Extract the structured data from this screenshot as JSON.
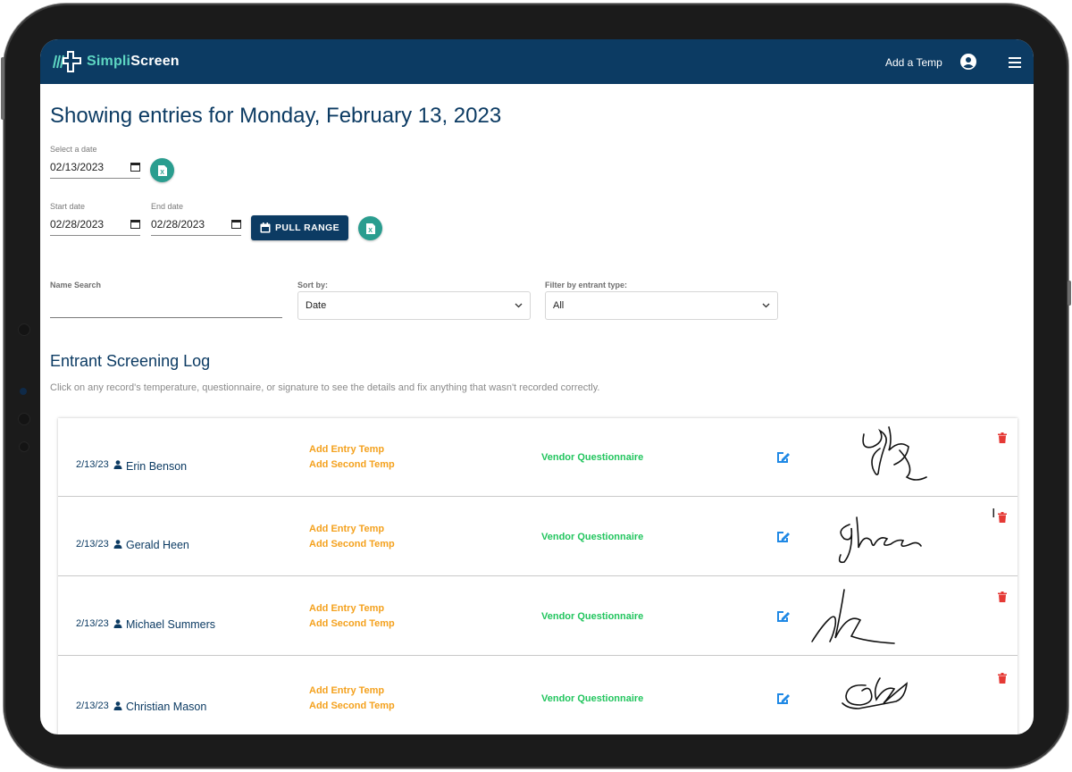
{
  "app": {
    "brand_part1": "Simpli",
    "brand_part2": "Screen",
    "add_temp_label": "Add a Temp",
    "icons": {
      "logo": "simpliscreen-logo",
      "user": "user-circle-icon",
      "menu": "hamburger-menu-icon"
    }
  },
  "page": {
    "title": "Showing entries for Monday, February 13, 2023"
  },
  "date_select": {
    "label": "Select a date",
    "value": "02/13/2023"
  },
  "range": {
    "start_label": "Start date",
    "start_value": "02/28/2023",
    "end_label": "End date",
    "end_value": "02/28/2023",
    "pull_button_label": "PULL RANGE"
  },
  "filters": {
    "name_search_label": "Name Search",
    "name_search_value": "",
    "sort_label": "Sort by:",
    "sort_value": "Date",
    "entrant_label": "Filter by entrant type:",
    "entrant_value": "All"
  },
  "log": {
    "title": "Entrant Screening Log",
    "hint": "Click on any record's temperature, questionnaire, or signature to see the details and fix anything that wasn't recorded correctly.",
    "rows": [
      {
        "date": "2/13/23",
        "name": "Erin Benson",
        "entry_temp": "Add Entry Temp",
        "second_temp": "Add Second Temp",
        "questionnaire": "Vendor Questionnaire"
      },
      {
        "date": "2/13/23",
        "name": "Gerald Heen",
        "entry_temp": "Add Entry Temp",
        "second_temp": "Add Second Temp",
        "questionnaire": "Vendor Questionnaire"
      },
      {
        "date": "2/13/23",
        "name": "Michael Summers",
        "entry_temp": "Add Entry Temp",
        "second_temp": "Add Second Temp",
        "questionnaire": "Vendor Questionnaire"
      },
      {
        "date": "2/13/23",
        "name": "Christian Mason",
        "entry_temp": "Add Entry Temp",
        "second_temp": "Add Second Temp",
        "questionnaire": "Vendor Questionnaire"
      }
    ]
  },
  "colors": {
    "navy": "#0c3b63",
    "teal": "#2a9d8f",
    "orange": "#f4a11d",
    "green": "#22c55e",
    "edit_blue": "#1e88e5",
    "trash_red": "#e53935"
  }
}
